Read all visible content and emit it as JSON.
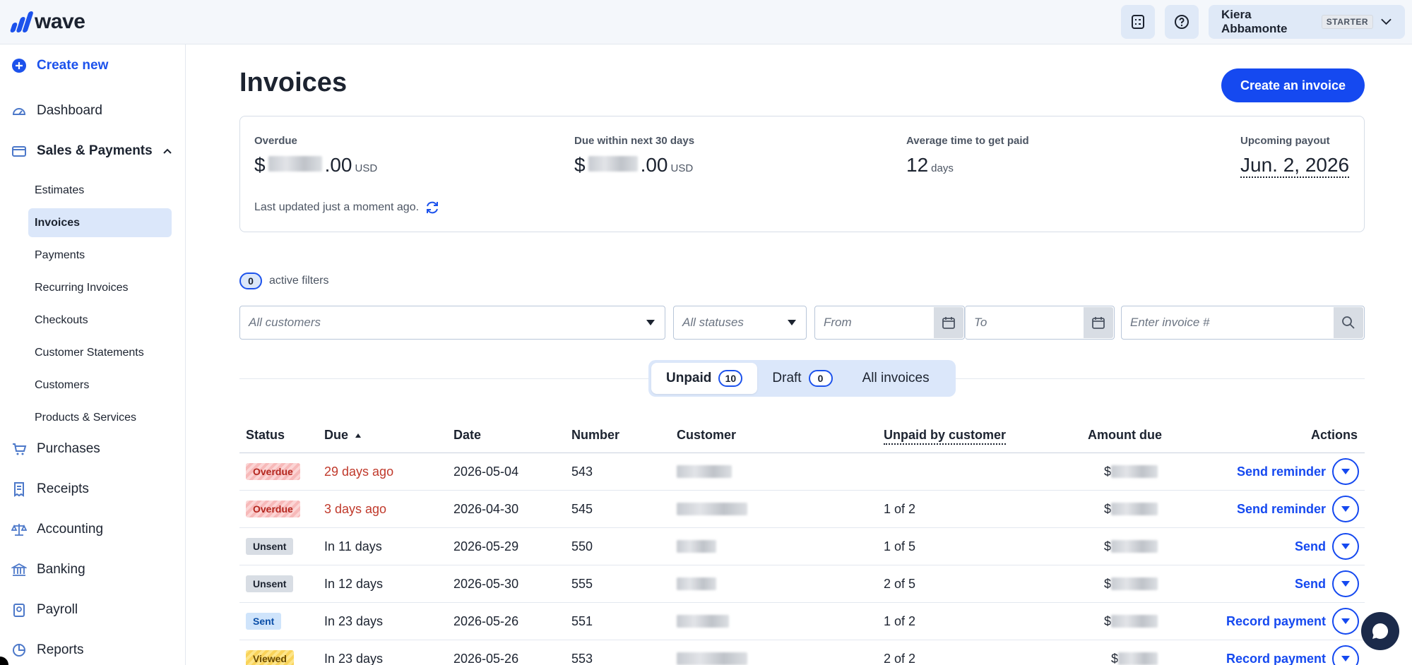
{
  "brand": {
    "name": "wave",
    "accent": "#1549f0"
  },
  "topbar": {
    "icons": [
      "checklist-icon",
      "help-icon"
    ],
    "user_name": "Kiera Abbamonte",
    "plan": "STARTER"
  },
  "sidebar": {
    "create_new": "Create new",
    "items": [
      {
        "label": "Dashboard",
        "icon": "dashboard-icon"
      },
      {
        "label": "Sales & Payments",
        "icon": "card-icon"
      },
      {
        "label": "Purchases",
        "icon": "cart-icon"
      },
      {
        "label": "Receipts",
        "icon": "receipt-icon"
      },
      {
        "label": "Accounting",
        "icon": "scale-icon"
      },
      {
        "label": "Banking",
        "icon": "bank-icon"
      },
      {
        "label": "Payroll",
        "icon": "payroll-icon"
      },
      {
        "label": "Reports",
        "icon": "reports-icon"
      }
    ],
    "sub_items": [
      "Estimates",
      "Invoices",
      "Payments",
      "Recurring Invoices",
      "Checkouts",
      "Customer Statements",
      "Customers",
      "Products & Services"
    ]
  },
  "main": {
    "title": "Invoices",
    "create_button": "Create an invoice",
    "summary": {
      "overdue_label": "Overdue",
      "overdue_prefix": "$",
      "overdue_suffix": ".00",
      "overdue_currency": "USD",
      "due30_label": "Due within next 30 days",
      "due30_prefix": "$",
      "due30_suffix": ".00",
      "due30_currency": "USD",
      "avg_label": "Average time to get paid",
      "avg_value": "12",
      "avg_unit": "days",
      "payout_label": "Upcoming payout",
      "payout_value": "Jun. 2, 2026",
      "last_updated": "Last updated just a moment ago."
    },
    "filters": {
      "active_count": "0",
      "active_label": "active filters",
      "customers_placeholder": "All customers",
      "statuses_placeholder": "All statuses",
      "from_placeholder": "From",
      "to_placeholder": "To",
      "invoice_placeholder": "Enter invoice #"
    },
    "tabs": [
      {
        "label": "Unpaid",
        "count": "10"
      },
      {
        "label": "Draft",
        "count": "0"
      },
      {
        "label": "All invoices",
        "count": ""
      }
    ],
    "table": {
      "headers": {
        "status": "Status",
        "due": "Due",
        "date": "Date",
        "number": "Number",
        "customer": "Customer",
        "unpaid": "Unpaid by customer",
        "amount": "Amount due",
        "actions": "Actions"
      },
      "rows": [
        {
          "status": "Overdue",
          "due": "29 days ago",
          "date": "2026-05-04",
          "number": "543",
          "unpaid": "",
          "amount_prefix": "$",
          "action": "Send reminder"
        },
        {
          "status": "Overdue",
          "due": "3 days ago",
          "date": "2026-04-30",
          "number": "545",
          "unpaid": "1 of 2",
          "amount_prefix": "$",
          "action": "Send reminder"
        },
        {
          "status": "Unsent",
          "due": "In 11 days",
          "date": "2026-05-29",
          "number": "550",
          "unpaid": "1 of 5",
          "amount_prefix": "$",
          "action": "Send"
        },
        {
          "status": "Unsent",
          "due": "In 12 days",
          "date": "2026-05-30",
          "number": "555",
          "unpaid": "2 of 5",
          "amount_prefix": "$",
          "action": "Send"
        },
        {
          "status": "Sent",
          "due": "In 23 days",
          "date": "2026-05-26",
          "number": "551",
          "unpaid": "1 of 2",
          "amount_prefix": "$",
          "action": "Record payment"
        },
        {
          "status": "Viewed",
          "due": "In 23 days",
          "date": "2026-05-26",
          "number": "553",
          "unpaid": "2 of 2",
          "amount_prefix": "$",
          "action": "Record payment"
        }
      ]
    }
  }
}
